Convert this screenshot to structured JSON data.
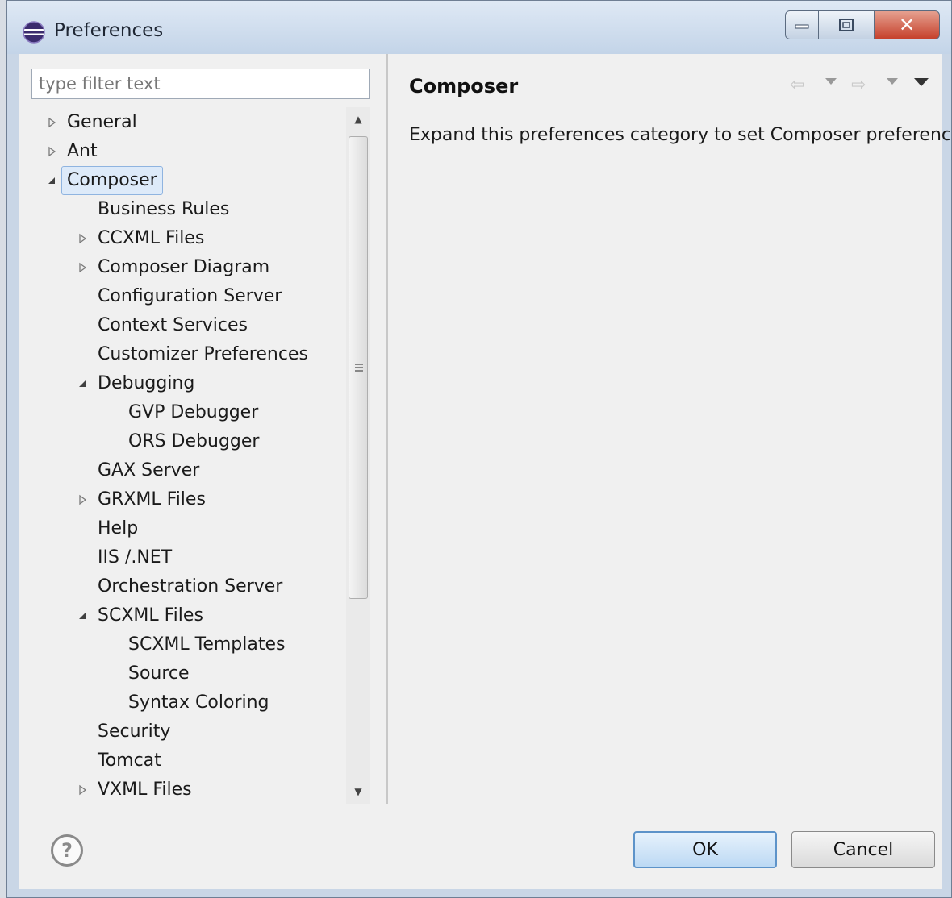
{
  "window": {
    "title": "Preferences",
    "icon": "eclipse-icon",
    "controls": {
      "minimize": "minimize-icon",
      "maximize": "maximize-icon",
      "close": "✕"
    }
  },
  "filter": {
    "placeholder": "type filter text",
    "value": ""
  },
  "tree": {
    "items": [
      {
        "label": "General",
        "level": 0,
        "state": "collapsed"
      },
      {
        "label": "Ant",
        "level": 0,
        "state": "collapsed"
      },
      {
        "label": "Composer",
        "level": 0,
        "state": "expanded",
        "selected": true
      },
      {
        "label": "Business Rules",
        "level": 1,
        "state": "leaf"
      },
      {
        "label": "CCXML Files",
        "level": 1,
        "state": "collapsed"
      },
      {
        "label": "Composer Diagram",
        "level": 1,
        "state": "collapsed"
      },
      {
        "label": "Configuration Server",
        "level": 1,
        "state": "leaf"
      },
      {
        "label": "Context Services",
        "level": 1,
        "state": "leaf"
      },
      {
        "label": "Customizer Preferences",
        "level": 1,
        "state": "leaf"
      },
      {
        "label": "Debugging",
        "level": 1,
        "state": "expanded"
      },
      {
        "label": "GVP Debugger",
        "level": 2,
        "state": "leaf"
      },
      {
        "label": "ORS Debugger",
        "level": 2,
        "state": "leaf"
      },
      {
        "label": "GAX Server",
        "level": 1,
        "state": "leaf"
      },
      {
        "label": "GRXML Files",
        "level": 1,
        "state": "collapsed"
      },
      {
        "label": "Help",
        "level": 1,
        "state": "leaf"
      },
      {
        "label": "IIS /.NET",
        "level": 1,
        "state": "leaf"
      },
      {
        "label": "Orchestration Server",
        "level": 1,
        "state": "leaf"
      },
      {
        "label": "SCXML Files",
        "level": 1,
        "state": "expanded"
      },
      {
        "label": "SCXML Templates",
        "level": 2,
        "state": "leaf"
      },
      {
        "label": "Source",
        "level": 2,
        "state": "leaf"
      },
      {
        "label": "Syntax Coloring",
        "level": 2,
        "state": "leaf"
      },
      {
        "label": "Security",
        "level": 1,
        "state": "leaf"
      },
      {
        "label": "Tomcat",
        "level": 1,
        "state": "leaf"
      },
      {
        "label": "VXML Files",
        "level": 1,
        "state": "collapsed"
      }
    ]
  },
  "page": {
    "title": "Composer",
    "description": "Expand this preferences category to set Composer preferences.",
    "nav": {
      "back": "⇦",
      "forward": "⇨"
    }
  },
  "buttons": {
    "help": "?",
    "ok": "OK",
    "cancel": "Cancel"
  },
  "colors": {
    "selection_bg": "#ddeaf9",
    "selection_border": "#8fb4e0",
    "close_red": "#c6412c"
  }
}
